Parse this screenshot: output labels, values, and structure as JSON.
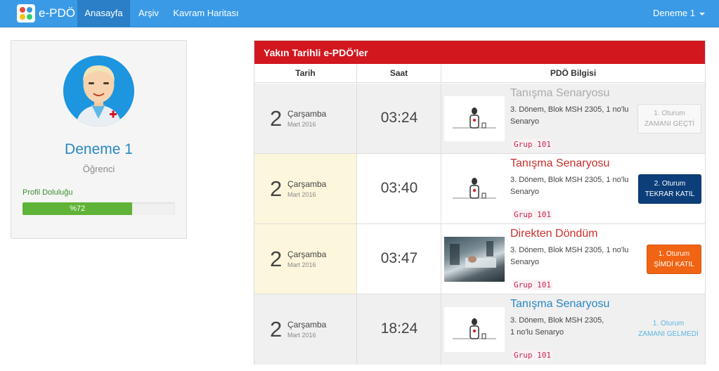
{
  "nav": {
    "brand": "e-PDÖ",
    "items": [
      "Anasayfa",
      "Arşiv",
      "Kavram Haritası"
    ],
    "user": "Deneme 1"
  },
  "profile": {
    "name": "Deneme 1",
    "role": "Öğrenci",
    "fill_label": "Profil Doluluğu",
    "fill_text": "%72",
    "fill_percent": 72
  },
  "panel": {
    "title": "Yakın Tarihli e-PDÖ'ler",
    "headers": [
      "Tarih",
      "Saat",
      "PDÖ Bilgisi"
    ]
  },
  "rows": [
    {
      "day": "2",
      "weekday": "Çarşamba",
      "month": "Mart 2016",
      "time": "03:24",
      "title": "Tanışma Senaryosu",
      "title_color": "#aaaaaa",
      "desc": "3. Dönem, Blok MSH 2305, 1 no'lu Senaryo",
      "group": "Grup 101",
      "action_line1": "1. Oturum",
      "action_line2": "ZAMANI GEÇTİ",
      "thumb": "figure-icon"
    },
    {
      "day": "2",
      "weekday": "Çarşamba",
      "month": "Mart 2016",
      "time": "03:40",
      "title": "Tanışma Senaryosu",
      "title_color": "#c9302c",
      "desc": "3. Dönem, Blok MSH 2305, 1 no'lu Senaryo",
      "group": "Grup 101",
      "action_line1": "2. Oturum",
      "action_line2": "TEKRAR KATIL",
      "thumb": "figure-icon"
    },
    {
      "day": "2",
      "weekday": "Çarşamba",
      "month": "Mart 2016",
      "time": "03:47",
      "title": "Direkten Döndüm",
      "title_color": "#c9302c",
      "desc": "3. Dönem, Blok MSH 2305, 1 no'lu Senaryo",
      "group": "Grup 101",
      "action_line1": "1. Oturum",
      "action_line2": "ŞİMDİ KATIL",
      "thumb": "hospital-photo"
    },
    {
      "day": "2",
      "weekday": "Çarşamba",
      "month": "Mart 2016",
      "time": "18:24",
      "title": "Tanışma Senaryosu",
      "title_color": "#2a86c4",
      "desc": "3. Dönem, Blok MSH 2305, 1 no'lu Senaryo",
      "group": "Grup 101",
      "action_line1": "1. Oturum",
      "action_line2": "ZAMANI GELMEDİ",
      "thumb": "figure-icon"
    }
  ]
}
